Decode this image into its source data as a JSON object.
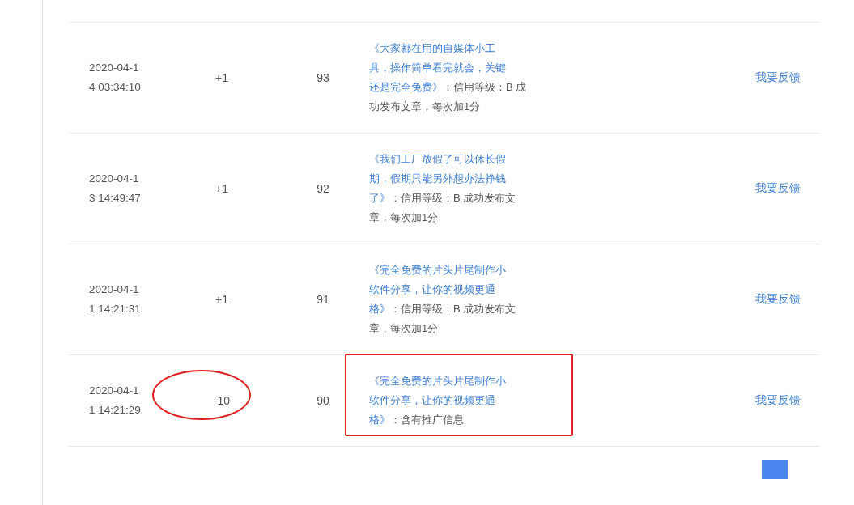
{
  "table": {
    "rows": [
      {
        "time": "2020-04-14 03:34:10",
        "change": "+1",
        "score": "93",
        "title_lines": [
          "《大家都在用的自媒体小工",
          "具，操作简单看完就会，关键",
          "还是完全免费》"
        ],
        "note": "：信用等级：B 成功发布文章，每次加1分",
        "feedback": "我要反馈",
        "change_circled": false,
        "description_boxed": false
      },
      {
        "time": "2020-04-13 14:49:47",
        "change": "+1",
        "score": "92",
        "title_lines": [
          "《我们工厂放假了可以休长假",
          "期，假期只能另外想办法挣钱",
          "了》"
        ],
        "note": "：信用等级：B 成功发布文章，每次加1分",
        "feedback": "我要反馈",
        "change_circled": false,
        "description_boxed": false
      },
      {
        "time": "2020-04-11 14:21:31",
        "change": "+1",
        "score": "91",
        "title_lines": [
          "《完全免费的片头片尾制作小",
          "软件分享，让你的视频更通",
          "格》"
        ],
        "note": "：信用等级：B 成功发布文章，每次加1分",
        "feedback": "我要反馈",
        "change_circled": false,
        "description_boxed": false
      },
      {
        "time": "2020-04-11 14:21:29",
        "change": "-10",
        "score": "90",
        "title_lines": [
          "《完全免费的片头片尾制作小",
          "软件分享，让你的视频更通",
          "格》"
        ],
        "note": "：含有推广信息",
        "feedback": "我要反馈",
        "change_circled": true,
        "description_boxed": true
      }
    ]
  }
}
